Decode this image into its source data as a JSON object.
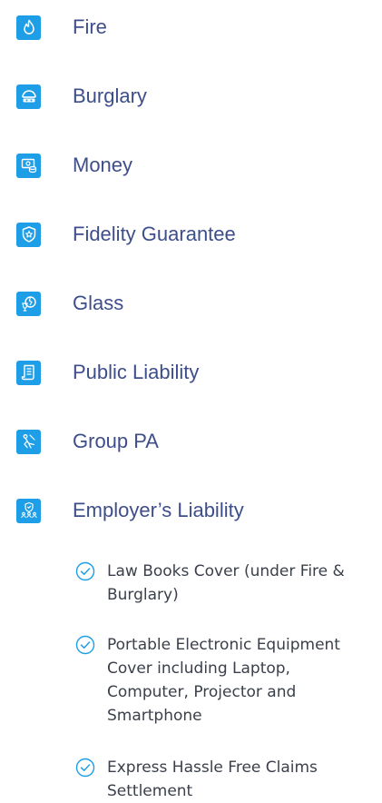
{
  "covers": [
    {
      "label": "Fire",
      "icon": "flame-icon"
    },
    {
      "label": "Burglary",
      "icon": "burglar-mask-icon"
    },
    {
      "label": "Money",
      "icon": "cash-coins-icon"
    },
    {
      "label": "Fidelity Guarantee",
      "icon": "shield-star-icon"
    },
    {
      "label": "Glass",
      "icon": "broken-glass-icon"
    },
    {
      "label": "Public Liability",
      "icon": "document-scroll-icon"
    },
    {
      "label": "Group PA",
      "icon": "accident-person-icon"
    },
    {
      "label": "Employer’s Liability",
      "icon": "shield-people-icon"
    }
  ],
  "benefits": [
    {
      "text": "Law Books Cover (under Fire & Burglary)"
    },
    {
      "text": "Portable Electronic Equipment Cover including Laptop, Computer, Projector and Smartphone"
    },
    {
      "text": "Express Hassle Free Claims Settlement"
    }
  ],
  "colors": {
    "accent_blue": "#1e9ee7",
    "label_navy": "#3d4e8a",
    "body_text": "#3a3f4a"
  }
}
